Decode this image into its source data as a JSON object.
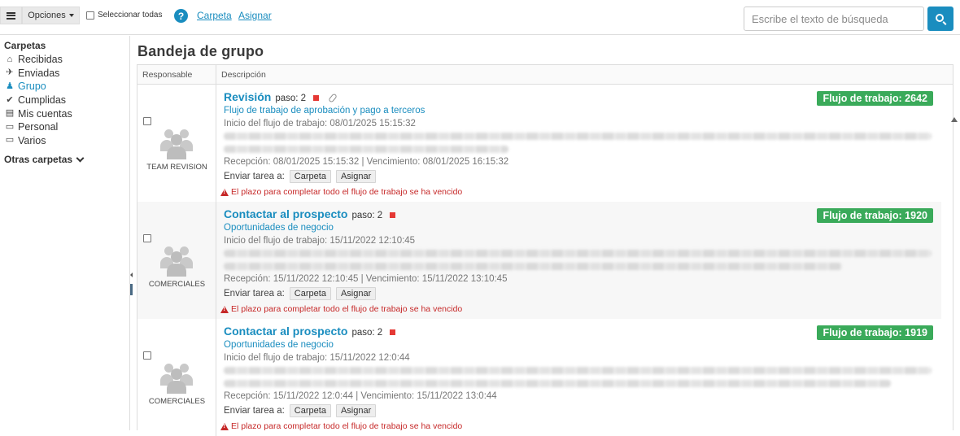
{
  "toolbar": {
    "options_label": "Opciones",
    "select_all_label": "Seleccionar todas",
    "help_glyph": "?",
    "folder_link": "Carpeta",
    "assign_link": "Asignar",
    "search_placeholder": "Escribe el texto de búsqueda"
  },
  "sidebar": {
    "folders_heading": "Carpetas",
    "items": [
      {
        "label": "Recibidas",
        "icon": "inbox-icon",
        "glyph": "⌂"
      },
      {
        "label": "Enviadas",
        "icon": "send-icon",
        "glyph": "✈"
      },
      {
        "label": "Grupo",
        "icon": "group-icon",
        "glyph": "♟"
      },
      {
        "label": "Cumplidas",
        "icon": "check-circle-icon",
        "glyph": "✔"
      },
      {
        "label": "Mis cuentas",
        "icon": "address-card-icon",
        "glyph": "▤"
      },
      {
        "label": "Personal",
        "icon": "folder-icon",
        "glyph": "▭"
      },
      {
        "label": "Varios",
        "icon": "folder-icon",
        "glyph": "▭"
      }
    ],
    "active_index": 2,
    "other_folders_label": "Otras carpetas"
  },
  "main": {
    "title": "Bandeja de grupo",
    "columns": {
      "responsible": "Responsable",
      "description": "Descripción"
    },
    "send_task_label": "Enviar tarea a:",
    "folder_button": "Carpeta",
    "assign_button": "Asignar",
    "rows": [
      {
        "responsible": "TEAM REVISION",
        "title": "Revisión",
        "step": "paso: 2",
        "has_attachment": true,
        "badge": "Flujo de trabajo: 2642",
        "flow_name": "Flujo de trabajo de aprobación y pago a terceros",
        "flow_start": "Inicio del flujo de trabajo: 08/01/2025 15:15:32",
        "reception": "Recepción: 08/01/2025 15:15:32 | Vencimiento: 08/01/2025 16:15:32",
        "warning": "El plazo para completar todo el flujo de trabajo se ha vencido"
      },
      {
        "responsible": "COMERCIALES",
        "title": "Contactar al prospecto",
        "step": "paso: 2",
        "has_attachment": false,
        "badge": "Flujo de trabajo: 1920",
        "flow_name": "Oportunidades de negocio",
        "flow_start": "Inicio del flujo de trabajo: 15/11/2022 12:10:45",
        "reception": "Recepción: 15/11/2022 12:10:45 | Vencimiento: 15/11/2022 13:10:45",
        "warning": "El plazo para completar todo el flujo de trabajo se ha vencido"
      },
      {
        "responsible": "COMERCIALES",
        "title": "Contactar al prospecto",
        "step": "paso: 2",
        "has_attachment": false,
        "badge": "Flujo de trabajo: 1919",
        "flow_name": "Oportunidades de negocio",
        "flow_start": "Inicio del flujo de trabajo: 15/11/2022 12:0:44",
        "reception": "Recepción: 15/11/2022 12:0:44 | Vencimiento: 15/11/2022 13:0:44",
        "warning": "El plazo para completar todo el flujo de trabajo se ha vencido"
      }
    ]
  },
  "colors": {
    "accent": "#1a8dbf",
    "badge_green": "#3aaa5a",
    "warning_red": "#c62828",
    "urgent_square": "#e53935"
  }
}
